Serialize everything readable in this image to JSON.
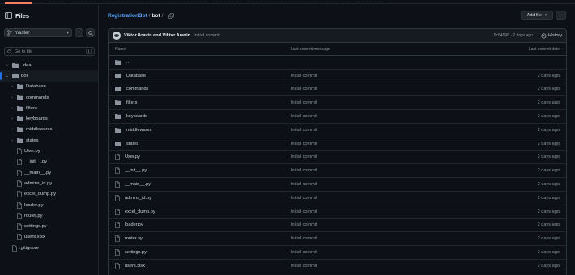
{
  "sidebar": {
    "title": "Files",
    "branch": "master",
    "add_label": "+",
    "goto_placeholder": "Go to file",
    "goto_shortcut": "t",
    "tree": [
      {
        "name": ".idea",
        "type": "folder",
        "depth": 0,
        "expanded": false
      },
      {
        "name": "bot",
        "type": "folder",
        "depth": 0,
        "expanded": true,
        "selected": true
      },
      {
        "name": "Database",
        "type": "folder",
        "depth": 1,
        "expanded": false
      },
      {
        "name": "commands",
        "type": "folder",
        "depth": 1,
        "expanded": false
      },
      {
        "name": "filters",
        "type": "folder",
        "depth": 1,
        "expanded": false
      },
      {
        "name": "keyboards",
        "type": "folder",
        "depth": 1,
        "expanded": false
      },
      {
        "name": "middlewares",
        "type": "folder",
        "depth": 1,
        "expanded": false
      },
      {
        "name": "states",
        "type": "folder",
        "depth": 1,
        "expanded": false
      },
      {
        "name": "User.py",
        "type": "file",
        "depth": 1
      },
      {
        "name": "__init__.py",
        "type": "file",
        "depth": 1
      },
      {
        "name": "__main__.py",
        "type": "file",
        "depth": 1
      },
      {
        "name": "admins_id.py",
        "type": "file",
        "depth": 1
      },
      {
        "name": "excel_dump.py",
        "type": "file",
        "depth": 1
      },
      {
        "name": "loader.py",
        "type": "file",
        "depth": 1
      },
      {
        "name": "router.py",
        "type": "file",
        "depth": 1
      },
      {
        "name": "settings.py",
        "type": "file",
        "depth": 1
      },
      {
        "name": "users.xlsx",
        "type": "file",
        "depth": 1
      },
      {
        "name": ".gitignore",
        "type": "file",
        "depth": 0
      }
    ]
  },
  "header": {
    "repo": "RegistrationBot",
    "sep1": "/",
    "dir": "bot",
    "sep2": "/",
    "add_file_label": "Add file",
    "more_label": "···"
  },
  "commit": {
    "authors": "Viktor Aravin and Viktor Aravin",
    "message": "Initial commit",
    "meta": "5c84598 · 2 days ago",
    "history_label": "History"
  },
  "table": {
    "headers": {
      "name": "Name",
      "message": "Last commit message",
      "date": "Last commit date"
    },
    "parent_label": "..",
    "rows": [
      {
        "name": "Database",
        "type": "folder",
        "message": "Initial commit",
        "date": "2 days ago"
      },
      {
        "name": "commands",
        "type": "folder",
        "message": "Initial commit",
        "date": "2 days ago"
      },
      {
        "name": "filters",
        "type": "folder",
        "message": "Initial commit",
        "date": "2 days ago"
      },
      {
        "name": "keyboards",
        "type": "folder",
        "message": "Initial commit",
        "date": "2 days ago"
      },
      {
        "name": "middlewares",
        "type": "folder",
        "message": "Initial commit",
        "date": "2 days ago"
      },
      {
        "name": "states",
        "type": "folder",
        "message": "Initial commit",
        "date": "2 days ago"
      },
      {
        "name": "User.py",
        "type": "file",
        "message": "Initial commit",
        "date": "2 days ago"
      },
      {
        "name": "__init__.py",
        "type": "file",
        "message": "Initial commit",
        "date": "2 days ago"
      },
      {
        "name": "__main__.py",
        "type": "file",
        "message": "Initial commit",
        "date": "2 days ago"
      },
      {
        "name": "admins_id.py",
        "type": "file",
        "message": "Initial commit",
        "date": "2 days ago"
      },
      {
        "name": "excel_dump.py",
        "type": "file",
        "message": "Initial commit",
        "date": "2 days ago"
      },
      {
        "name": "loader.py",
        "type": "file",
        "message": "Initial commit",
        "date": "2 days ago"
      },
      {
        "name": "router.py",
        "type": "file",
        "message": "Initial commit",
        "date": "2 days ago"
      },
      {
        "name": "settings.py",
        "type": "file",
        "message": "Initial commit",
        "date": "2 days ago"
      },
      {
        "name": "users.xlsx",
        "type": "file",
        "message": "Initial commit",
        "date": "2 days ago"
      }
    ]
  },
  "colors": {
    "accent": "#58a6ff",
    "folder": "#8b949e",
    "background": "#0d1117"
  },
  "icons": {
    "sidebar_panel": "sidebar-panel-icon",
    "branch": "git-branch-icon",
    "search": "search-icon",
    "folder": "folder-icon",
    "file": "file-icon",
    "copy": "copy-path-icon",
    "history": "history-icon"
  }
}
